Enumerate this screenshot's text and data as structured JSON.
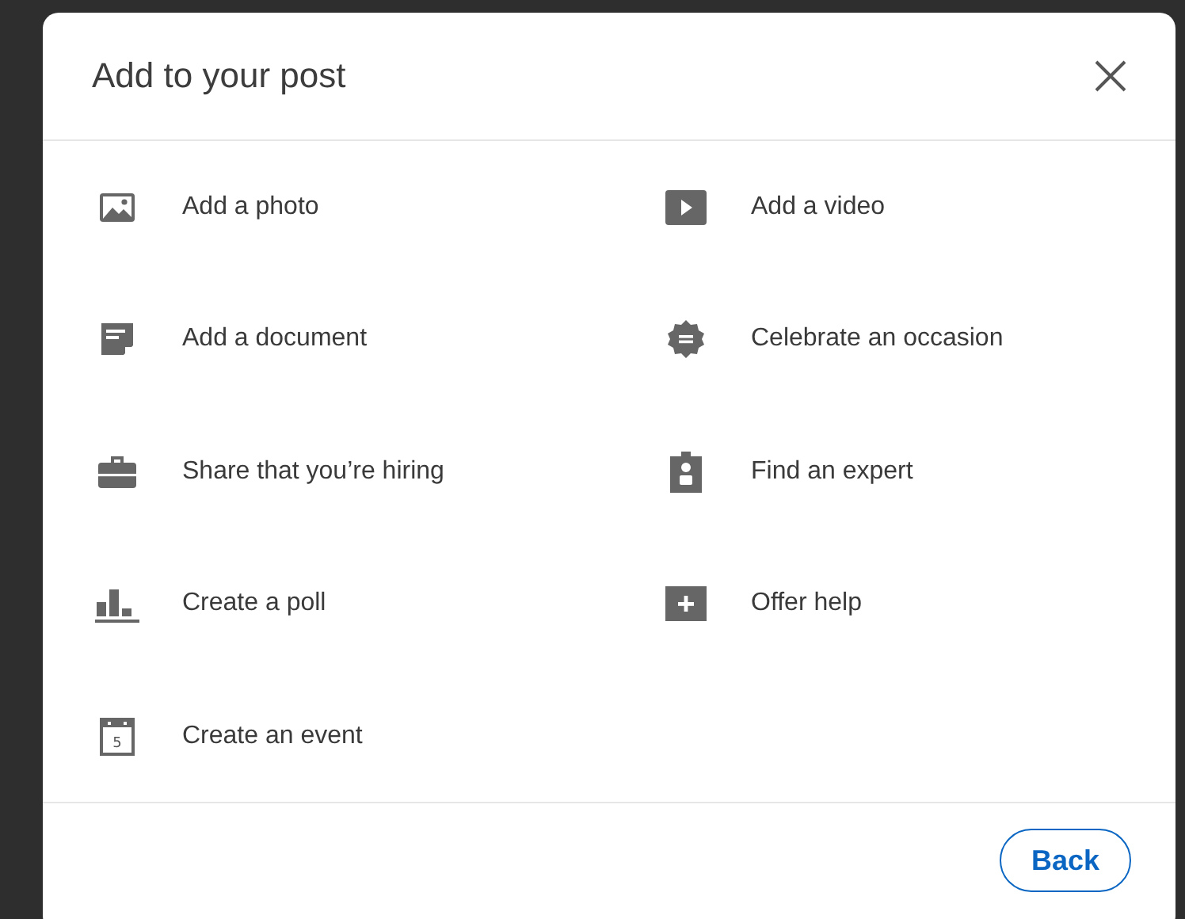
{
  "dialog": {
    "title": "Add to your post"
  },
  "items": [
    {
      "kind": "photo",
      "label": "Add a photo"
    },
    {
      "kind": "video",
      "label": "Add a video"
    },
    {
      "kind": "document",
      "label": "Add a document"
    },
    {
      "kind": "occasion",
      "label": "Celebrate an occasion"
    },
    {
      "kind": "hiring",
      "label": "Share that you’re hiring"
    },
    {
      "kind": "expert",
      "label": "Find an expert"
    },
    {
      "kind": "poll",
      "label": "Create a poll"
    },
    {
      "kind": "help",
      "label": "Offer help"
    },
    {
      "kind": "event",
      "label": "Create an event",
      "icon_text": "5"
    }
  ],
  "footer": {
    "button": "Back"
  }
}
